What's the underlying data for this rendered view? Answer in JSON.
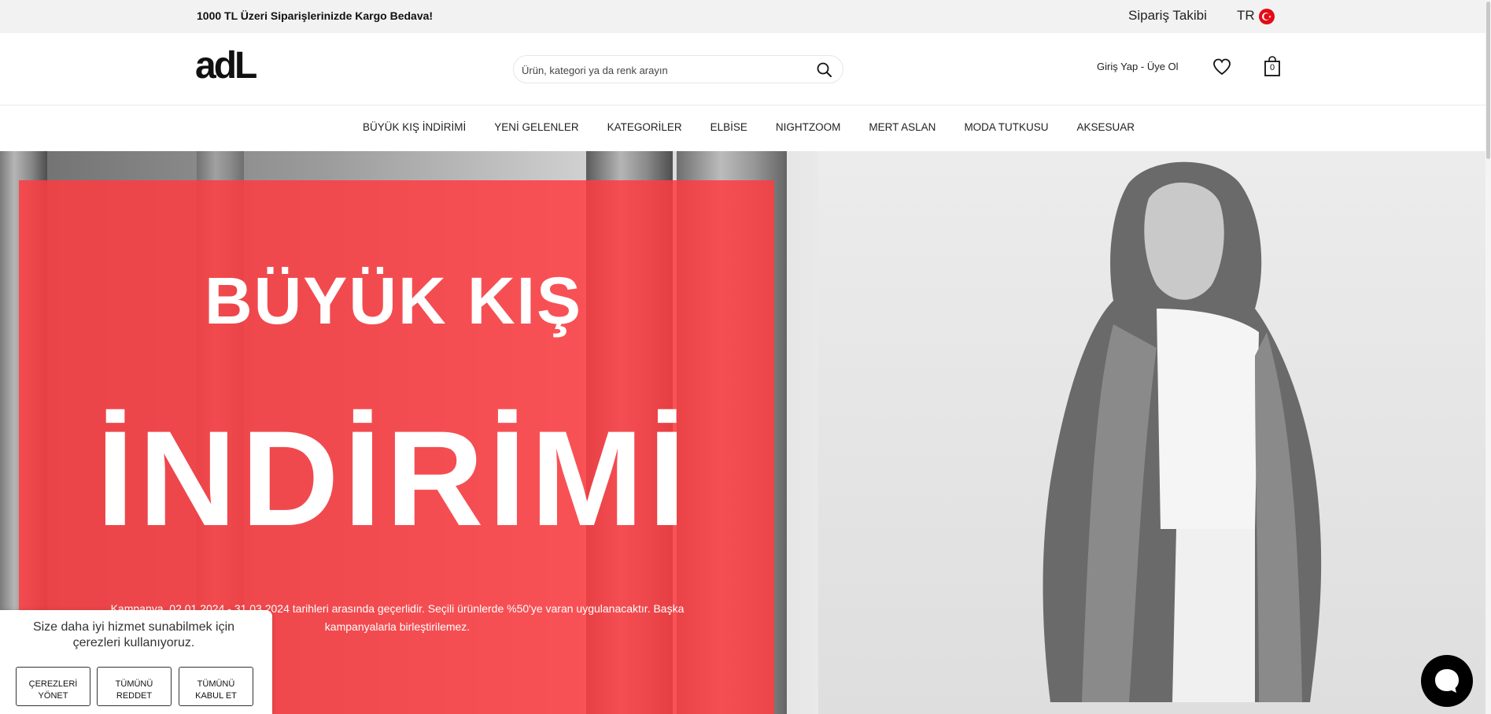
{
  "topbar": {
    "promo": "1000 TL Üzeri Siparişlerinizde Kargo Bedava!",
    "order_tracking": "Sipariş Takibi",
    "language": "TR"
  },
  "header": {
    "logo": "adL",
    "search_placeholder": "Ürün, kategori ya da renk arayın",
    "login_signup": "Giriş Yap - Üye Ol",
    "cart_count": "0"
  },
  "nav": {
    "items": [
      "BÜYÜK KIŞ İNDİRİMİ",
      "YENİ GELENLER",
      "KATEGORİLER",
      "ELBİSE",
      "NIGHTZOOM",
      "MERT ASLAN",
      "MODA TUTKUSU",
      "AKSESUAR"
    ]
  },
  "hero": {
    "heading_line1": "BÜYÜK KIŞ",
    "heading_line2": "İNDİRİMİ",
    "terms": "Kampanya, 02.01.2024 - 31.03.2024 tarihleri arasında geçerlidir. Seçili ürünlerde %50'ye varan uygulanacaktır. Başka kampanyalarla birleştirilemez."
  },
  "cookie": {
    "message": "Size daha iyi hizmet sunabilmek için çerezleri kullanıyoruz.",
    "manage_line1": "ÇEREZLERİ",
    "manage_line2": "YÖNET",
    "reject_line1": "TÜMÜNÜ",
    "reject_line2": "REDDET",
    "accept_line1": "TÜMÜNÜ",
    "accept_line2": "KABUL ET"
  },
  "colors": {
    "promo_red": "#ff3c41",
    "topbar_bg": "#f2f2f2",
    "flag_red": "#e30a17"
  },
  "icons": [
    "turkey-flag-icon",
    "search-icon",
    "heart-icon",
    "shopping-bag-icon",
    "chat-icon"
  ]
}
